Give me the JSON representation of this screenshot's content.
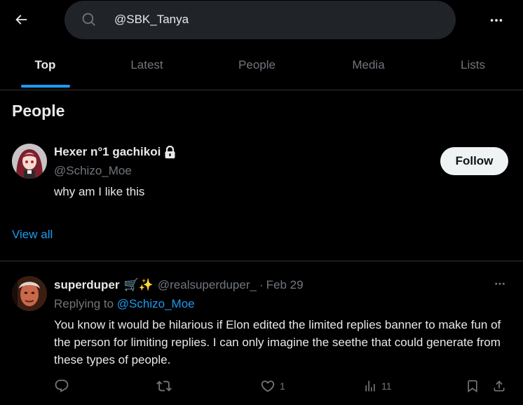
{
  "search": {
    "query": "@SBK_Tanya"
  },
  "tabs": [
    {
      "label": "Top"
    },
    {
      "label": "Latest"
    },
    {
      "label": "People"
    },
    {
      "label": "Media"
    },
    {
      "label": "Lists"
    }
  ],
  "active_tab": "Top",
  "people": {
    "title": "People",
    "user": {
      "name": "Hexer n°1 gachikoi",
      "handle": "@Schizo_Moe",
      "bio": "why am I like this",
      "follow_label": "Follow"
    },
    "view_all": "View all"
  },
  "post": {
    "author_name": "superduper",
    "author_emoji": "🛒✨",
    "author_handle": "@realsuperduper_",
    "separator": "·",
    "date": "Feb 29",
    "replying_prefix": "Replying to",
    "replying_handle": "@Schizo_Moe",
    "text": "You know it would be hilarious if Elon edited the limited replies banner to make fun of the person for limiting replies. I can only imagine the seethe that could generate from these types of people.",
    "actions": {
      "reply_count": "",
      "repost_count": "",
      "like_count": "1",
      "views_count": "11"
    }
  },
  "colors": {
    "background": "#000000",
    "accent": "#1d9bf0",
    "text_primary": "#e7e9ea",
    "text_secondary": "#71767b",
    "search_bg": "#202327",
    "divider": "#2f3336"
  }
}
